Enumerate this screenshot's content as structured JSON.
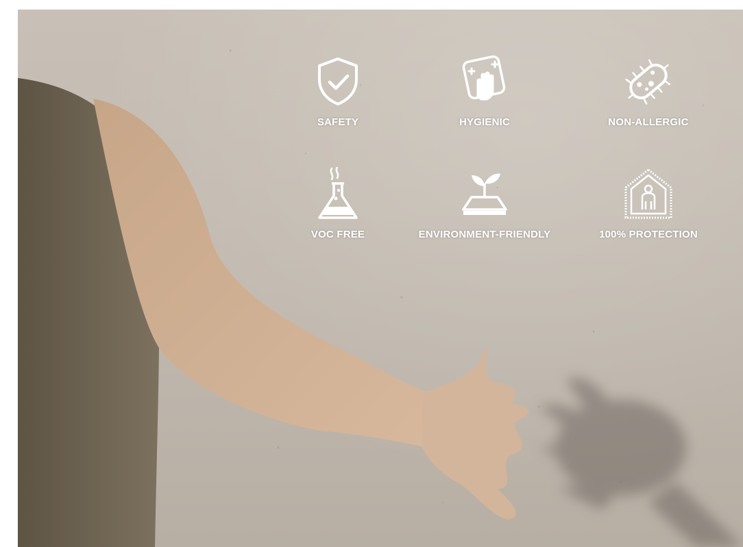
{
  "features": [
    {
      "label": "SAFETY",
      "icon": "shield-check-icon"
    },
    {
      "label": "HYGIENIC",
      "icon": "hand-wipe-icon"
    },
    {
      "label": "NON-ALLERGIC",
      "icon": "bacteria-icon"
    },
    {
      "label": "VOC FREE",
      "icon": "flask-icon"
    },
    {
      "label": "ENVIRONMENT-FRIENDLY",
      "icon": "sprout-surface-icon"
    },
    {
      "label": "100% PROTECTION",
      "icon": "protected-house-person-icon"
    }
  ],
  "colors": {
    "label": "#ffffff",
    "background": "#c1b9af",
    "skin": "#c9a98c",
    "shirt": "#6f6452",
    "shadow": "#7d7670"
  }
}
